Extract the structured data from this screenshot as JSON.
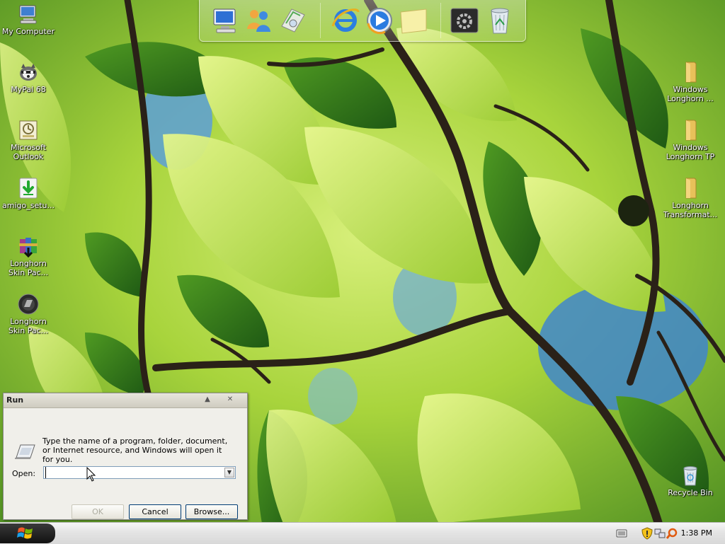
{
  "desktop": {
    "icons_left": [
      {
        "label1": "My Computer",
        "label2": "",
        "icon": "my-computer-icon"
      },
      {
        "label1": "MyPal 68",
        "label2": "",
        "icon": "mypal-icon"
      },
      {
        "label1": "Microsoft",
        "label2": "Outlook",
        "icon": "outlook-icon"
      },
      {
        "label1": "amigo_setu...",
        "label2": "",
        "icon": "installer-icon"
      },
      {
        "label1": "Longhorn",
        "label2": "Skin Pac...",
        "icon": "winrar-icon"
      },
      {
        "label1": "Longhorn",
        "label2": "Skin Pac...",
        "icon": "disc-icon"
      }
    ],
    "icons_right": [
      {
        "label1": "Windows",
        "label2": "Longhorn ...",
        "icon": "folder-icon"
      },
      {
        "label1": "Windows",
        "label2": "Longhorn TP",
        "icon": "folder-icon"
      },
      {
        "label1": "Longhorn",
        "label2": "Transformat...",
        "icon": "folder-icon"
      }
    ],
    "recycle_bin": {
      "label": "Recycle Bin",
      "icon": "recycle-bin-icon"
    }
  },
  "dock": {
    "items": [
      "computer-icon",
      "users-icon",
      "network-icon",
      "internet-explorer-icon",
      "media-player-icon",
      "sticky-note-icon",
      "settings-icon",
      "recycle-bin-icon"
    ]
  },
  "run_dialog": {
    "title": "Run",
    "description": "Type the name of a program, folder, document, or Internet resource, and Windows will open it for you.",
    "open_label": "Open:",
    "open_value": "",
    "ok_label": "OK",
    "cancel_label": "Cancel",
    "browse_label": "Browse..."
  },
  "taskbar": {
    "clock": "1:38 PM"
  },
  "colors": {
    "accent": "#003c74",
    "leaf_light": "#b8e04a",
    "leaf_dark": "#3f7f1a",
    "sky": "#4a8fd0"
  }
}
